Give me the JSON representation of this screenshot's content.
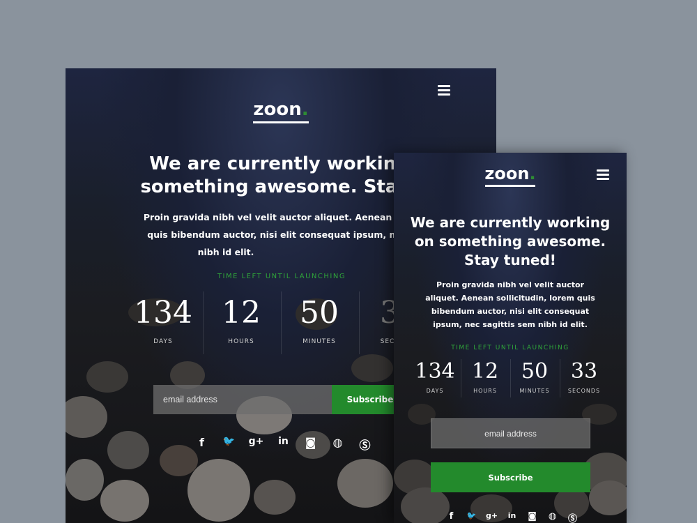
{
  "brand": {
    "name": "zoon",
    "dot": "."
  },
  "headline_desktop_1": "We are currently working o",
  "headline_desktop_2": "something awesome. Stay tu",
  "para_desktop_1": "Proin gravida nibh vel velit auctor aliquet. Aenean sollicitu",
  "para_desktop_2": "quis bibendum auctor, nisi elit consequat ipsum, nec sagi",
  "para_desktop_3": "nibh id elit.",
  "headline_mobile_1": "We are currently working",
  "headline_mobile_2": "on something awesome.",
  "headline_mobile_3": "Stay tuned!",
  "para_mobile_1": "Proin gravida nibh vel velit auctor",
  "para_mobile_2": "aliquet. Aenean sollicitudin, lorem quis",
  "para_mobile_3": "bibendum auctor, nisi elit consequat",
  "para_mobile_4": "ipsum, nec sagittis sem nibh id elit.",
  "time_left_label": "TIME LEFT UNTIL LAUNCHING",
  "countdown": [
    {
      "value": "134",
      "label": "DAYS"
    },
    {
      "value": "12",
      "label": "HOURS"
    },
    {
      "value": "50",
      "label": "MINUTES"
    },
    {
      "value": "33",
      "label": "SECONDS"
    }
  ],
  "desktop_seconds_partial": "3",
  "desktop_seconds_label_partial": "SECO",
  "email_placeholder": "email address",
  "subscribe_label": "Subscribe",
  "social_icons": [
    "facebook-icon",
    "twitter-icon",
    "google-plus-icon",
    "linkedin-icon",
    "instagram-icon",
    "dribbble-icon",
    "skype-icon"
  ],
  "social_glyphs": {
    "facebook": "f",
    "twitter": "🐦",
    "google_plus": "g+",
    "linkedin": "in",
    "instagram": "◙",
    "dribbble": "◍",
    "skype": "Ⓢ"
  },
  "colors": {
    "accent": "#238a2c",
    "label_green": "#2fa53a",
    "outer_bg": "#8a939d"
  }
}
